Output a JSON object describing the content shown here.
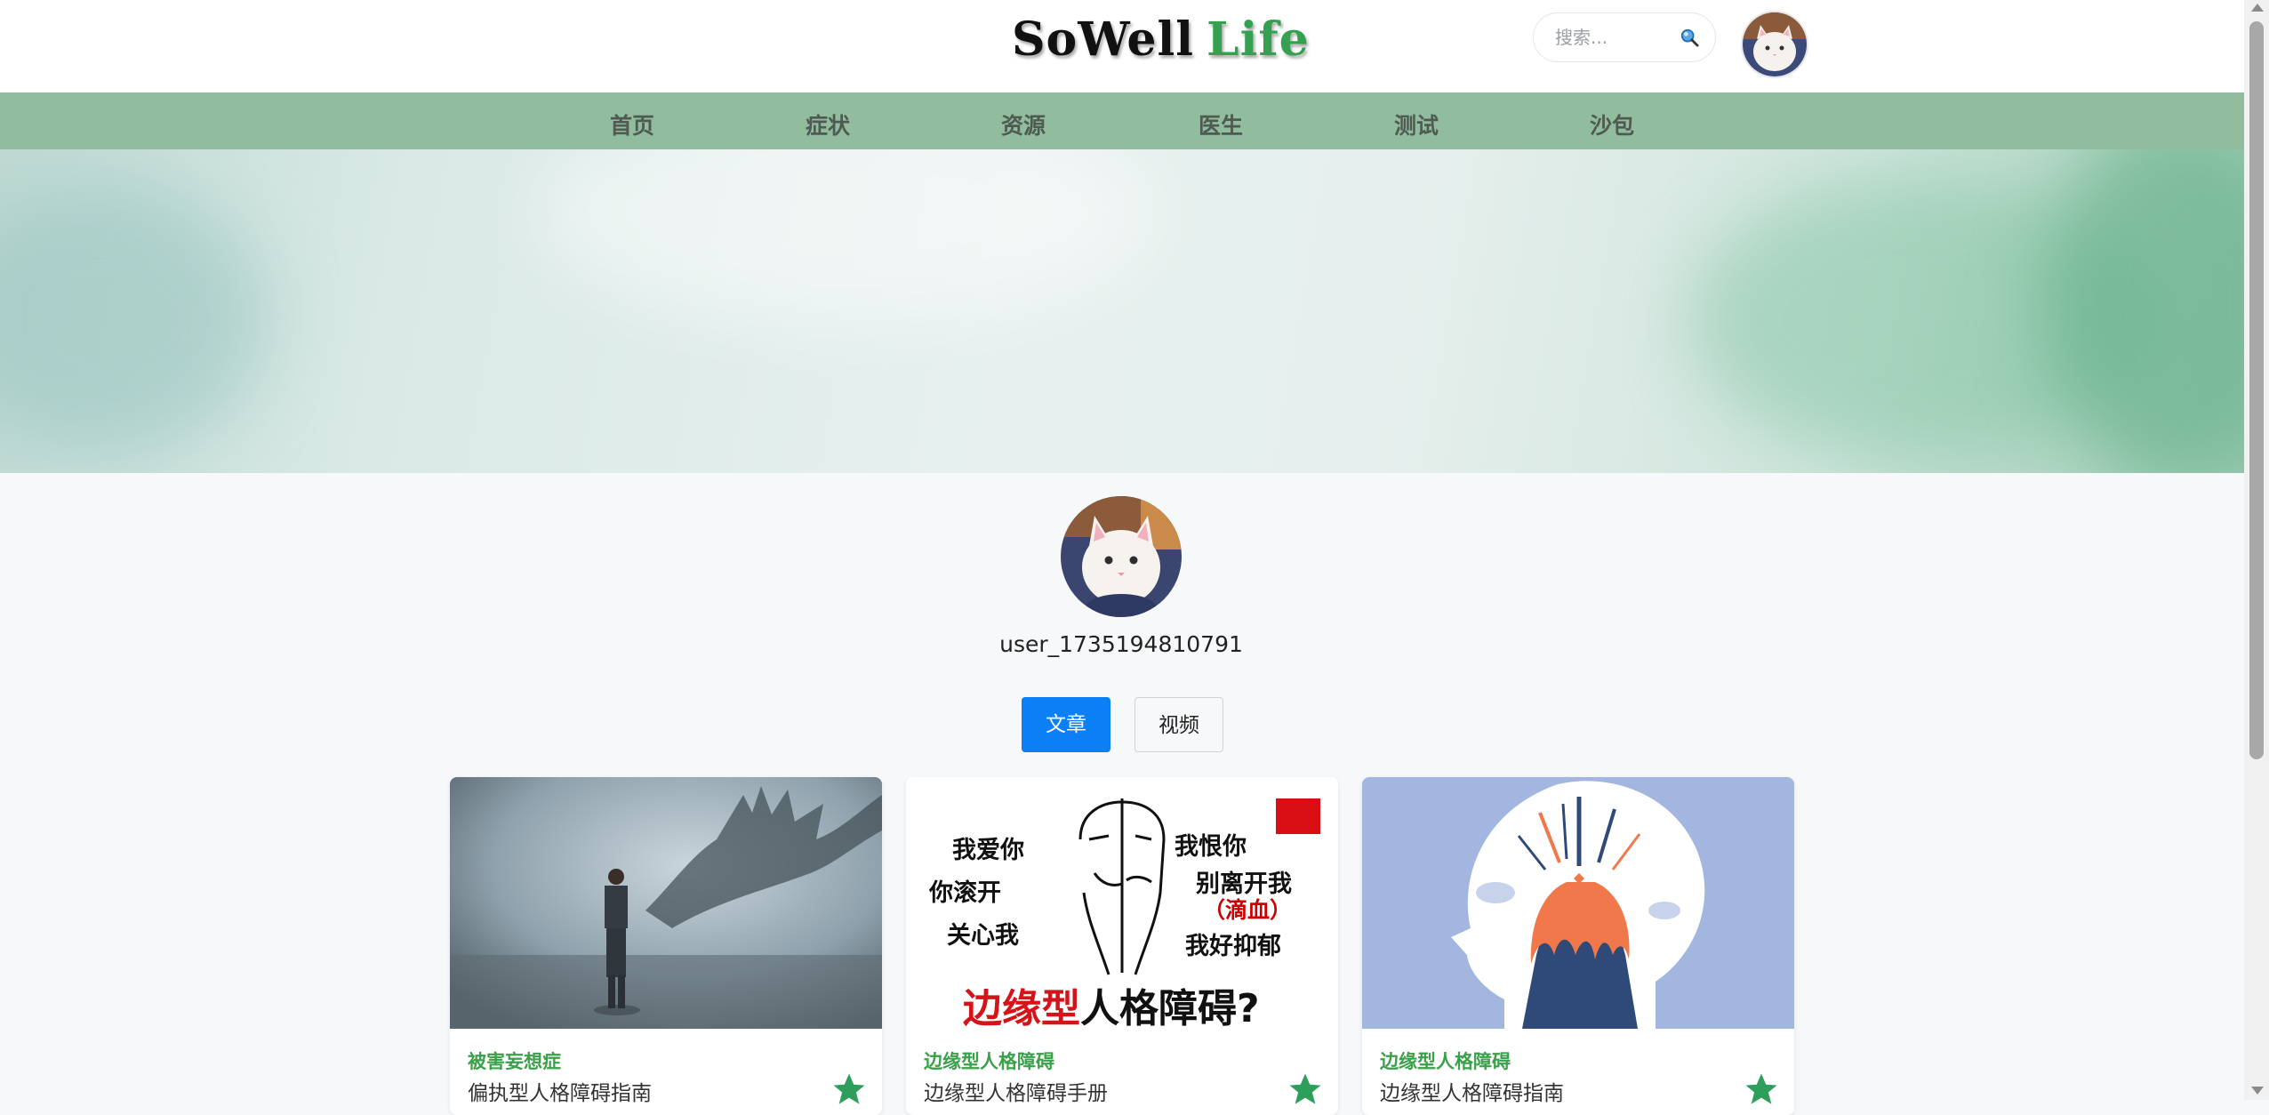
{
  "header": {
    "logo_part1": "SoWell",
    "logo_part2": "Life",
    "search_placeholder": "搜索..."
  },
  "nav": {
    "items": [
      "首页",
      "症状",
      "资源",
      "医生",
      "测试",
      "沙包"
    ]
  },
  "profile": {
    "username": "user_1735194810791"
  },
  "tabs": {
    "articles": "文章",
    "videos": "视频",
    "active": "articles"
  },
  "cards": [
    {
      "category": "被害妄想症",
      "title": "偏执型人格障碍指南"
    },
    {
      "category": "边缘型人格障碍",
      "title": "边缘型人格障碍手册",
      "image_text": {
        "left": [
          "我爱你",
          "你滚开",
          "关心我"
        ],
        "right": [
          "我恨你",
          "别离开我",
          "（滴血）",
          "我好抑郁"
        ],
        "headline_red": "边缘型",
        "headline_black": "人格障碍?"
      }
    },
    {
      "category": "边缘型人格障碍",
      "title": "边缘型人格障碍指南"
    }
  ],
  "colors": {
    "nav_bg": "#91bd9e",
    "accent_green": "#3aa04a",
    "primary_blue": "#0b7ff5",
    "star_green": "#2e9e5b"
  },
  "icons": {
    "search": "search-icon",
    "star": "star-icon"
  }
}
